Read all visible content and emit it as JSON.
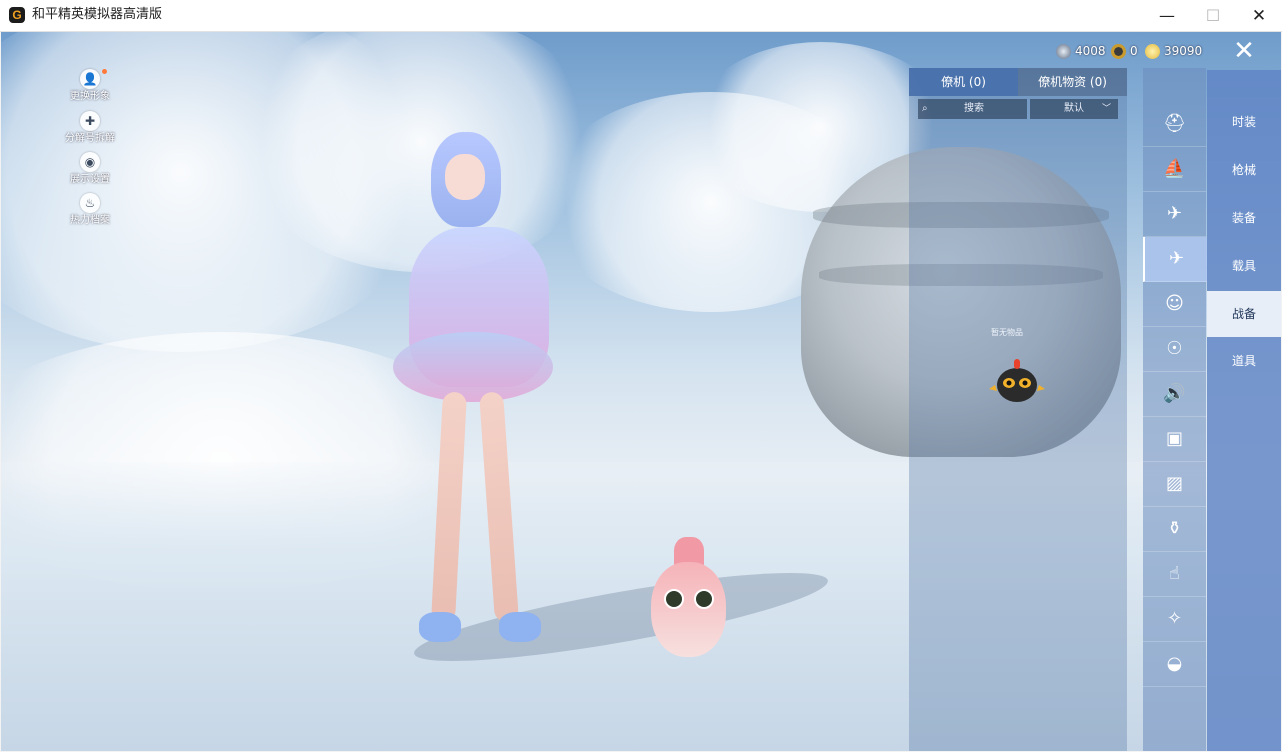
{
  "window": {
    "logo": "G",
    "title": "和平精英模拟器高清版",
    "minimize": "—",
    "maximize": "☐",
    "close": "✕"
  },
  "left_menu": [
    {
      "label": "更换形象",
      "icon": "avatar-icon",
      "glyph": "👤"
    },
    {
      "label": "分解号拆解",
      "icon": "puzzle-icon",
      "glyph": "✚"
    },
    {
      "label": "展示设置",
      "icon": "eye-icon",
      "glyph": "◉"
    },
    {
      "label": "热力档案",
      "icon": "flame-icon",
      "glyph": "♨"
    }
  ],
  "currency": [
    {
      "value": "4008",
      "color": "#5a6a82"
    },
    {
      "value": "0",
      "color": "#c99a2e"
    },
    {
      "value": "39090",
      "color": "#e2b93b"
    }
  ],
  "game_close": "✕",
  "panel": {
    "tabs": [
      "僚机 (0)",
      "僚机物资 (0)"
    ],
    "search_placeholder": "搜索",
    "sort_value": "默认",
    "empty_text": "暂无物品"
  },
  "icon_column": [
    {
      "icon": "helmet-icon",
      "glyph": "⛑"
    },
    {
      "icon": "boat-icon",
      "glyph": "⛵"
    },
    {
      "icon": "drone-icon",
      "glyph": "✈"
    },
    {
      "icon": "glider-icon",
      "glyph": "✈"
    },
    {
      "icon": "face-icon",
      "glyph": "☺"
    },
    {
      "icon": "robot-icon",
      "glyph": "☉"
    },
    {
      "icon": "speaker-icon",
      "glyph": "🔊"
    },
    {
      "icon": "pet-icon",
      "glyph": "▣"
    },
    {
      "icon": "picture-icon",
      "glyph": "▨"
    },
    {
      "icon": "spray-icon",
      "glyph": "⚱"
    },
    {
      "icon": "hand-icon",
      "glyph": "☝"
    },
    {
      "icon": "sparkle-icon",
      "glyph": "✧"
    },
    {
      "icon": "dish-icon",
      "glyph": "◒"
    }
  ],
  "categories": [
    "时装",
    "枪械",
    "装备",
    "载具",
    "战备",
    "道具"
  ],
  "active_category": "战备",
  "active_icon": "glider-icon"
}
